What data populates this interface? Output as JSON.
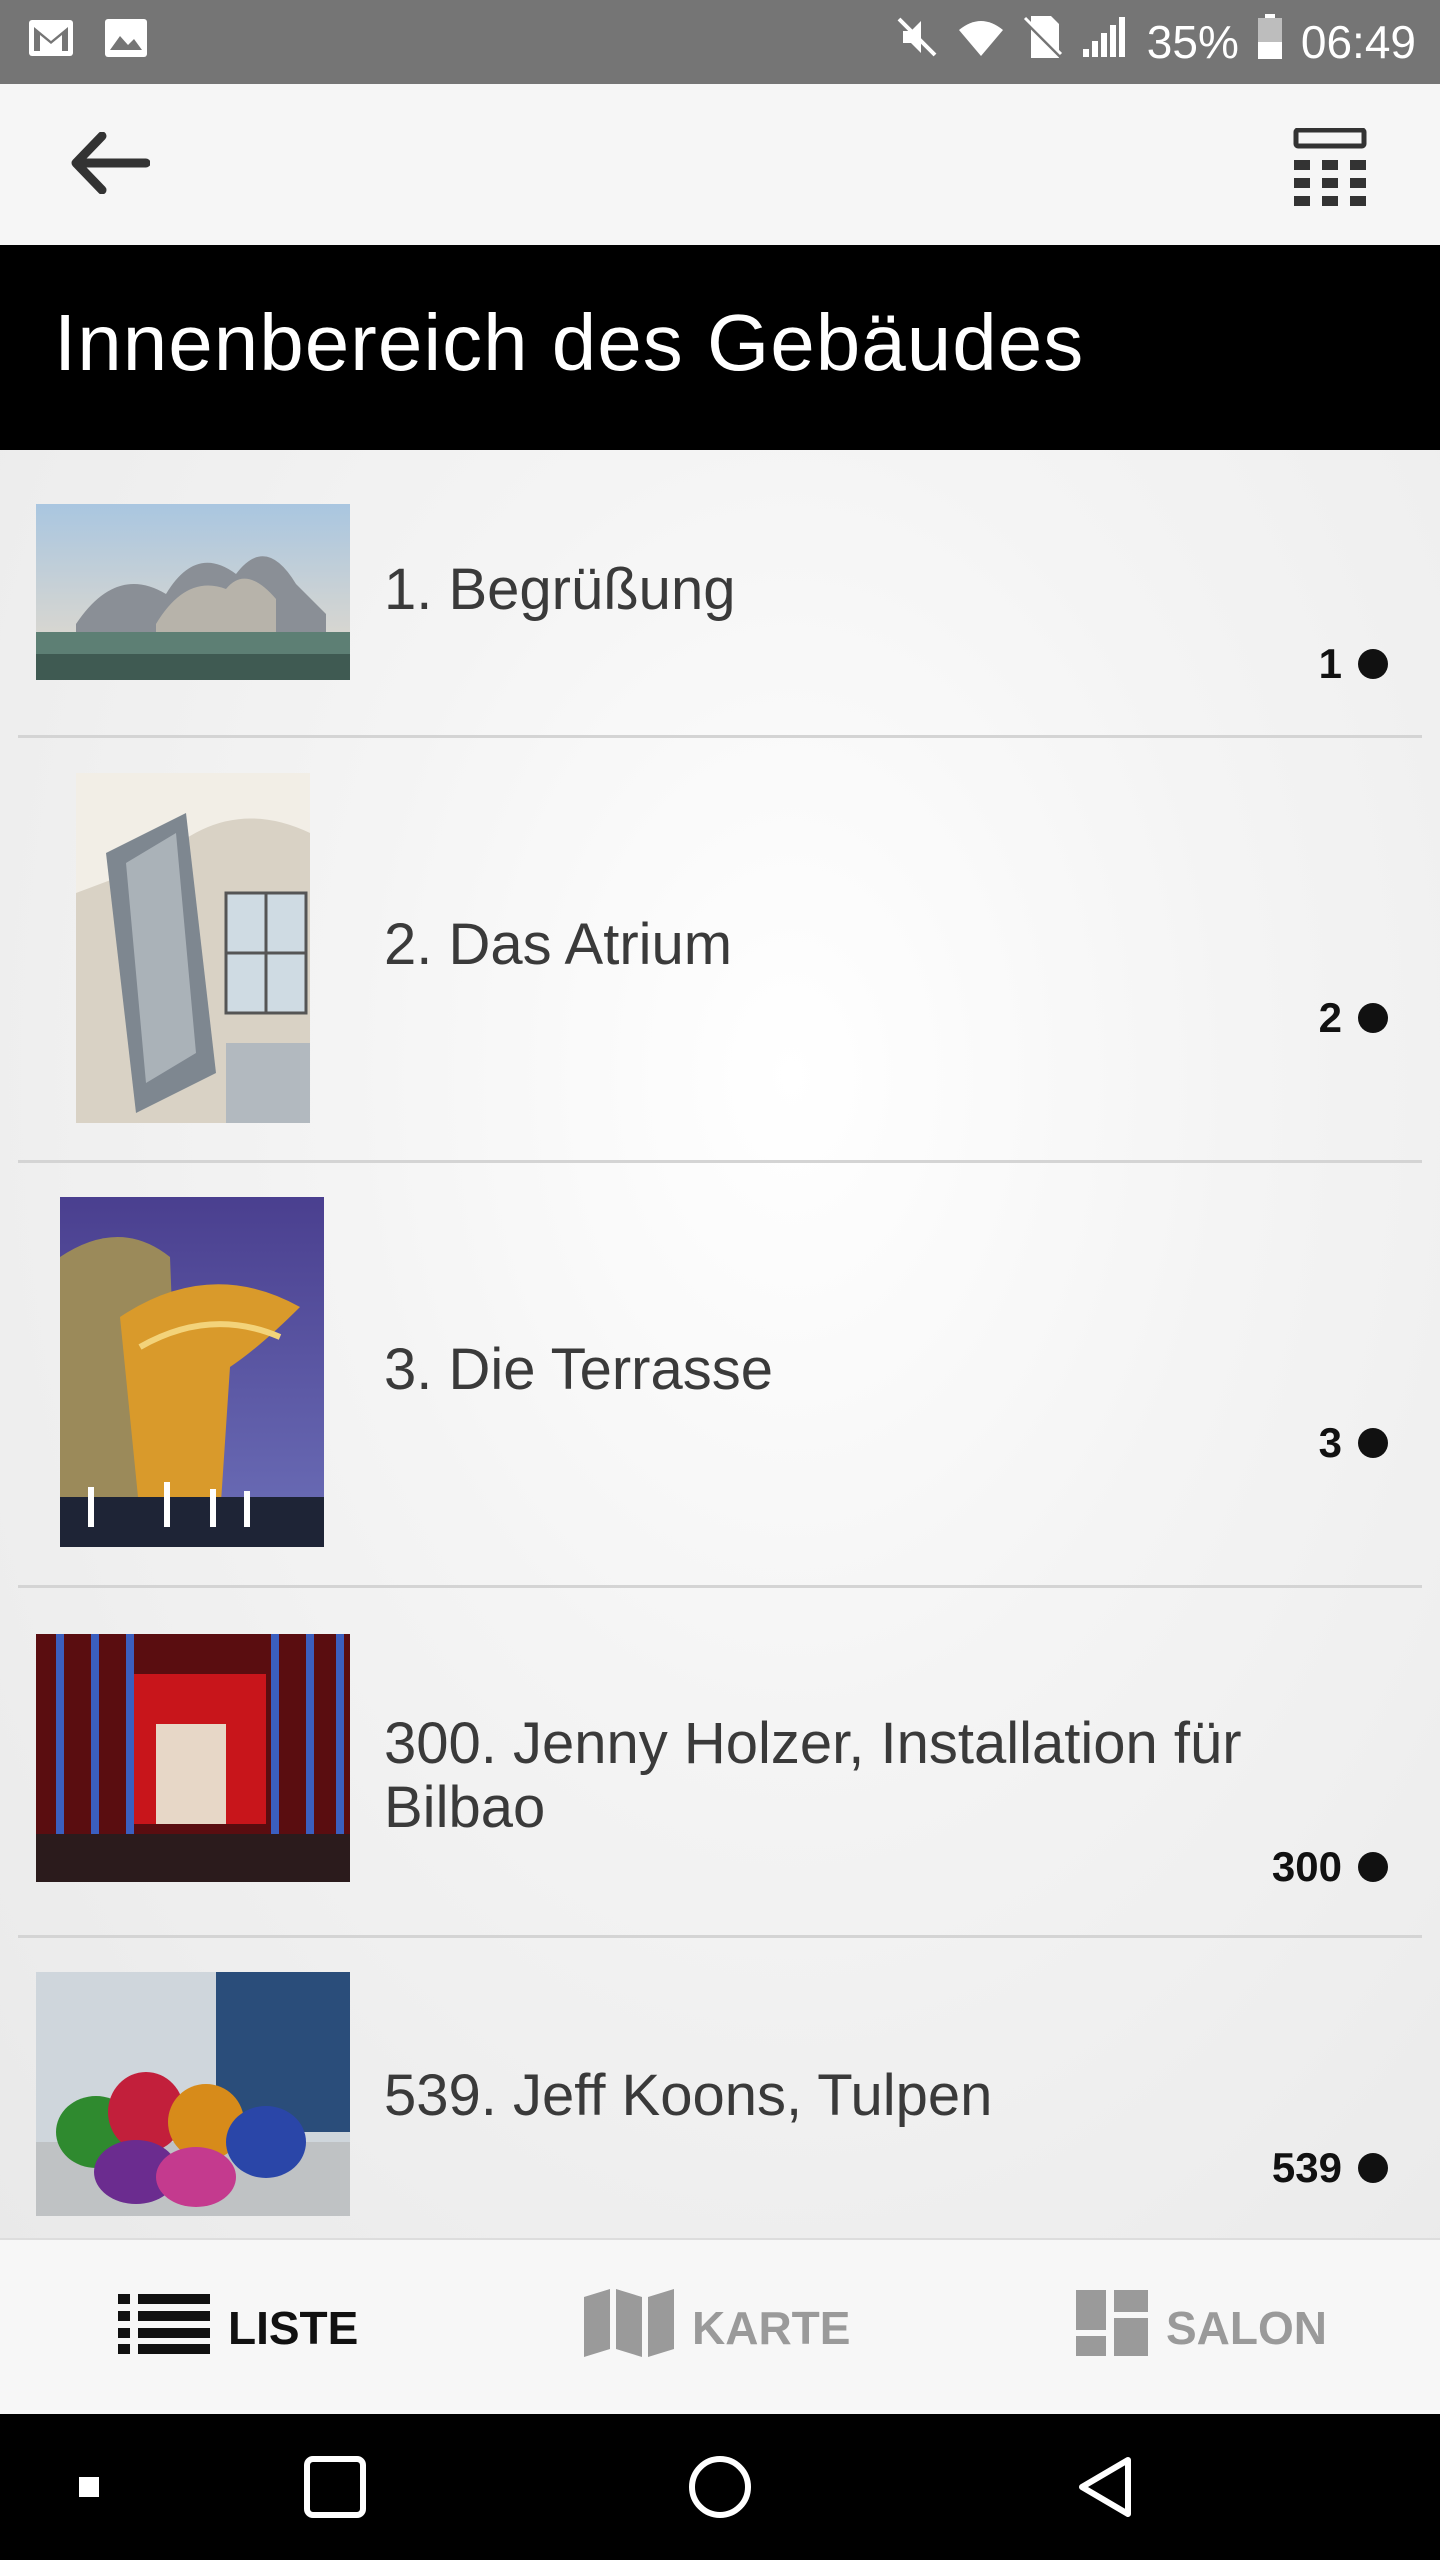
{
  "status_bar": {
    "left_icons": [
      "gmail-icon",
      "gallery-icon"
    ],
    "right_icons": [
      "mute-icon",
      "wifi-icon",
      "no-sim-icon",
      "signal-icon"
    ],
    "battery_percent": "35%",
    "time": "06:49"
  },
  "app_bar": {
    "back_icon": "arrow-left-icon",
    "keypad_icon": "keypad-icon"
  },
  "section": {
    "title": "Innenbereich des Gebäudes"
  },
  "items": [
    {
      "title": "1. Begrüßung",
      "number": "1"
    },
    {
      "title": "2. Das Atrium",
      "number": "2"
    },
    {
      "title": "3. Die Terrasse",
      "number": "3"
    },
    {
      "title": "300. Jenny Holzer, Installation für Bilbao",
      "number": "300"
    },
    {
      "title": "539. Jeff Koons, Tulpen",
      "number": "539"
    }
  ],
  "tabs": [
    {
      "label": "LISTE",
      "icon": "list-icon",
      "active": true
    },
    {
      "label": "KARTE",
      "icon": "map-icon",
      "active": false
    },
    {
      "label": "SALON",
      "icon": "dashboard-icon",
      "active": false
    }
  ],
  "nav_bar": [
    "recents-dot-icon",
    "square-icon",
    "home-circle-icon",
    "back-triangle-icon"
  ]
}
